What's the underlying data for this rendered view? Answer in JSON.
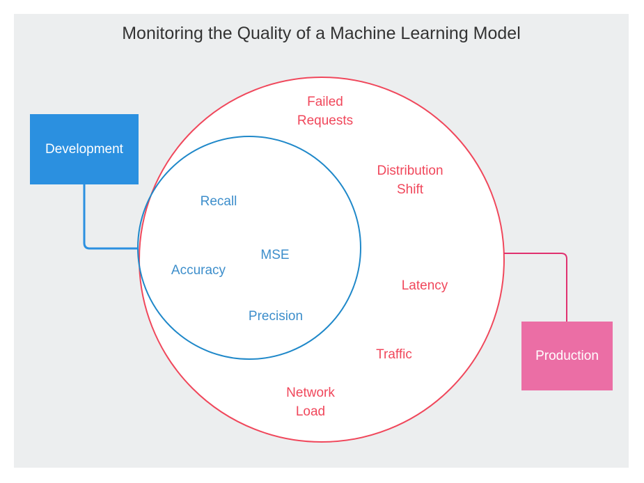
{
  "title": "Monitoring the Quality of a Machine Learning Model",
  "nodes": {
    "development": "Development",
    "production": "Production"
  },
  "inner_metrics": {
    "recall": "Recall",
    "mse": "MSE",
    "accuracy": "Accuracy",
    "precision": "Precision"
  },
  "outer_metrics": {
    "failed_requests": "Failed\nRequests",
    "distribution_shift": "Distribution\nShift",
    "latency": "Latency",
    "traffic": "Traffic",
    "network_load": "Network\nLoad"
  },
  "colors": {
    "outer_circle": "#f0475b",
    "inner_circle": "#1f88c9",
    "development": "#2b90e0",
    "production": "#eb6ea5",
    "background": "#eceeef"
  }
}
